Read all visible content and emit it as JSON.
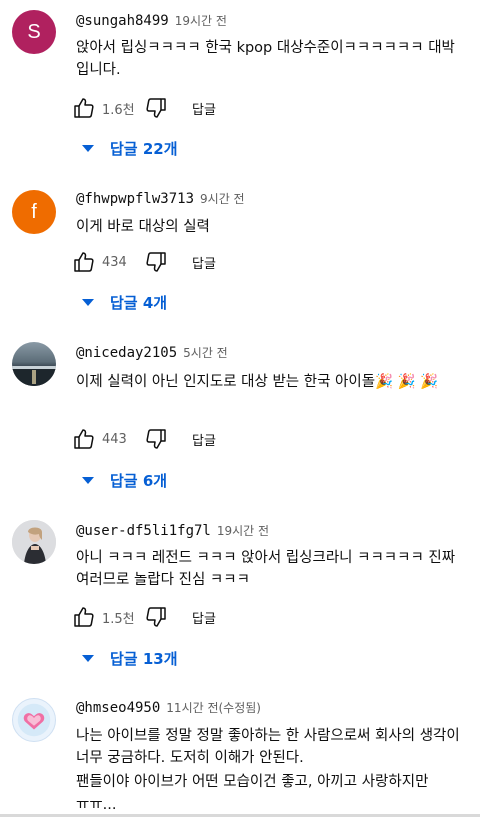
{
  "comments": [
    {
      "avatar_letter": "S",
      "avatar_color": "#b0215f",
      "author": "@sungah8499",
      "time": "19시간 전",
      "text": "앉아서 립싱ㅋㅋㅋㅋ 한국 kpop 대상수준이ㅋㅋㅋㅋㅋㅋ 대박입니다.",
      "likes": "1.6천",
      "reply_label": "답글",
      "replies": "답글 22개"
    },
    {
      "avatar_letter": "f",
      "avatar_color": "#ef6c00",
      "author": "@fhwpwpflw3713",
      "time": "9시간 전",
      "text": "이게 바로 대상의 실력",
      "likes": "434",
      "reply_label": "답글",
      "replies": "답글 4개"
    },
    {
      "avatar_letter": "",
      "avatar_color": "#4a5a66",
      "author": "@niceday2105",
      "time": "5시간 전",
      "text": "이제 실력이 아닌 인지도로 대상 받는 한국 아이돌🎉 🎉 🎉",
      "likes": "443",
      "reply_label": "답글",
      "replies": "답글 6개"
    },
    {
      "avatar_letter": "",
      "avatar_color": "#cfcfcf",
      "author": "@user-df5li1fg7l",
      "time": "19시간 전",
      "text": "아니 ㅋㅋㅋ 레전드 ㅋㅋㅋ 앉아서 립싱크라니 ㅋㅋㅋㅋㅋ 진짜 여러므로 놀랍다 진심 ㅋㅋㅋ",
      "likes": "1.5천",
      "reply_label": "답글",
      "replies": "답글 13개"
    },
    {
      "avatar_letter": "",
      "avatar_color": "#e8f1fb",
      "author": "@hmseo4950",
      "time": "11시간 전(수정됨)",
      "text": "나는 아이브를 정말 정말 좋아하는 한 사람으로써 회사의 생각이 너무 궁금하다. 도저히 이해가 안된다.",
      "text2": "팬들이야 아이브가 어떤 모습이건 좋고, 아끼고 사랑하지만",
      "text3": "ㅠㅠ..."
    }
  ]
}
